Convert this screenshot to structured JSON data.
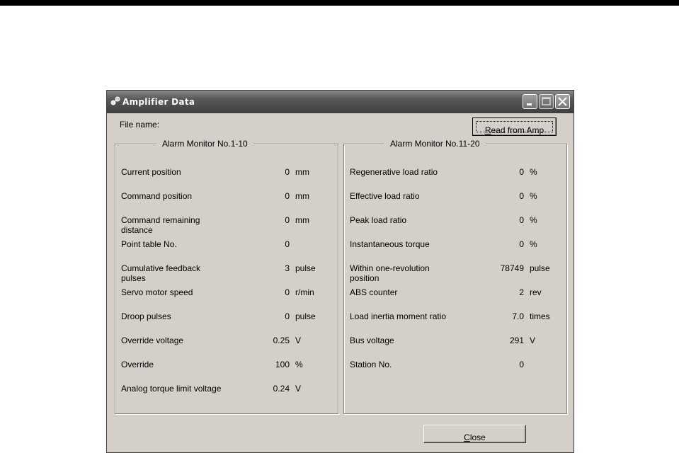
{
  "window": {
    "title": "Amplifier Data"
  },
  "file": {
    "label": "File name:"
  },
  "buttons": {
    "read_pre": "",
    "read_key": "R",
    "read_post": "ead from Amp",
    "close_key": "C",
    "close_post": "lose"
  },
  "left_group": {
    "title": "Alarm Monitor No.1-10",
    "rows": [
      {
        "label": "Current position",
        "value": "0",
        "unit": "mm"
      },
      {
        "label": "Command position",
        "value": "0",
        "unit": "mm"
      },
      {
        "label": "Command remaining distance",
        "value": "0",
        "unit": "mm"
      },
      {
        "label": "Point table No.",
        "value": "0",
        "unit": ""
      },
      {
        "label": "Cumulative feedback pulses",
        "value": "3",
        "unit": "pulse"
      },
      {
        "label": "Servo motor speed",
        "value": "0",
        "unit": "r/min"
      },
      {
        "label": "Droop pulses",
        "value": "0",
        "unit": "pulse"
      },
      {
        "label": "Override voltage",
        "value": "0.25",
        "unit": "V"
      },
      {
        "label": "Override",
        "value": "100",
        "unit": "%"
      },
      {
        "label": "Analog torque limit voltage",
        "value": "0.24",
        "unit": "V"
      }
    ]
  },
  "right_group": {
    "title": "Alarm Monitor No.11-20",
    "rows": [
      {
        "label": "Regenerative load ratio",
        "value": "0",
        "unit": "%"
      },
      {
        "label": "Effective load ratio",
        "value": "0",
        "unit": "%"
      },
      {
        "label": "Peak load ratio",
        "value": "0",
        "unit": "%"
      },
      {
        "label": "Instantaneous torque",
        "value": "0",
        "unit": "%"
      },
      {
        "label": "Within one-revolution position",
        "value": "78749",
        "unit": "pulse"
      },
      {
        "label": "ABS counter",
        "value": "2",
        "unit": "rev"
      },
      {
        "label": "Load inertia moment ratio",
        "value": "7.0",
        "unit": "times"
      },
      {
        "label": "Bus voltage",
        "value": "291",
        "unit": "V"
      },
      {
        "label": "Station No.",
        "value": "0",
        "unit": ""
      }
    ]
  },
  "colors": {
    "dialog_bg": "#d4d0c8",
    "titlebar": "#5a5a5a"
  }
}
